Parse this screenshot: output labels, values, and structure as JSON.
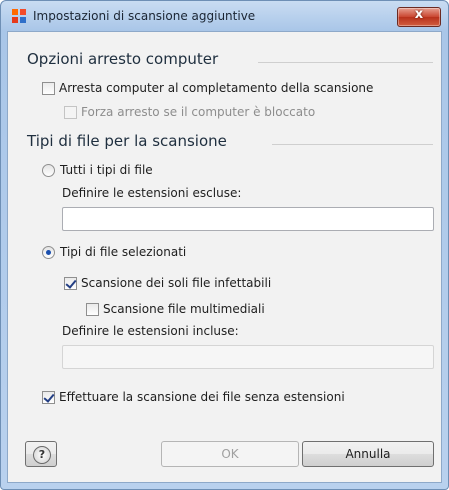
{
  "window": {
    "title": "Impostazioni di scansione aggiuntive",
    "close_label": "x"
  },
  "shutdown": {
    "heading": "Opzioni arresto computer",
    "shutdown_on_complete": {
      "label": "Arresta computer al completamento della scansione",
      "checked": false
    },
    "force_shutdown": {
      "label": "Forza arresto se il computer è bloccato",
      "checked": false,
      "enabled": false
    }
  },
  "file_types": {
    "heading": "Tipi di file per la scansione",
    "all_types": {
      "label": "Tutti i tipi di file",
      "selected": false
    },
    "exclude_label": "Definire le estensioni escluse:",
    "exclude_value": "",
    "selected_types": {
      "label": "Tipi di file selezionati",
      "selected": true
    },
    "infectable_only": {
      "label": "Scansione dei soli file infettabili",
      "checked": true
    },
    "multimedia": {
      "label": "Scansione file multimediali",
      "checked": false
    },
    "include_label": "Definire le estensioni incluse:",
    "include_value": "",
    "no_extension": {
      "label": "Effettuare la scansione dei file senza estensioni",
      "checked": true
    }
  },
  "buttons": {
    "help": "?",
    "ok": "OK",
    "cancel": "Annulla"
  },
  "colors": {
    "titlebar": "#b9d1ee",
    "close_button": "#c9452f",
    "radio_dot": "#1a4fae"
  },
  "icons": {
    "app": "avast-app-icon",
    "close": "close-icon",
    "help": "help-icon"
  }
}
